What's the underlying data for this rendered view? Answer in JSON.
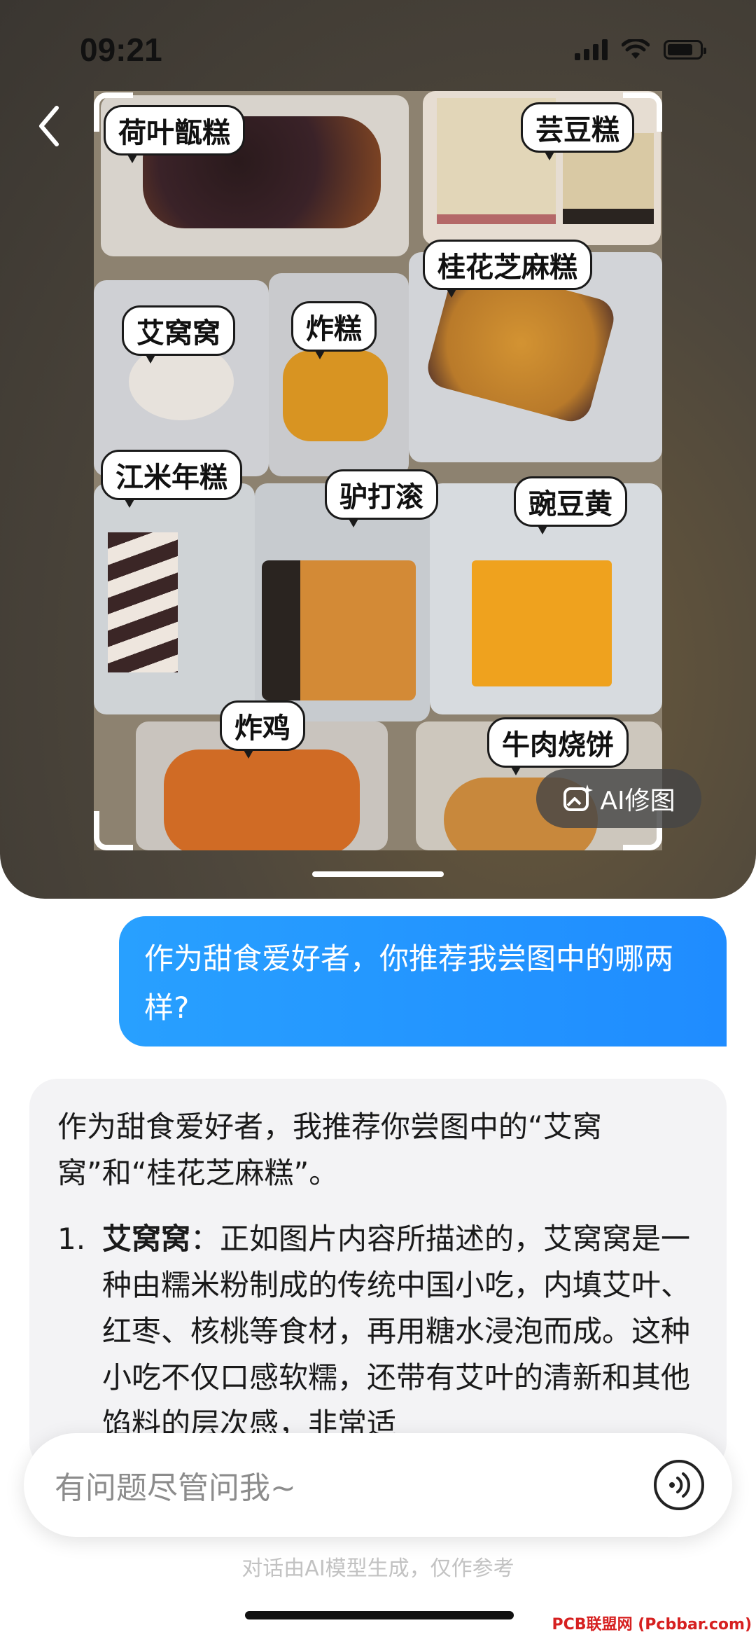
{
  "status_bar": {
    "time": "09:21"
  },
  "photo": {
    "labels": {
      "heye_zhengao": "荷叶甑糕",
      "yundougao": "芸豆糕",
      "guihua_zhimagao": "桂花芝麻糕",
      "aiwowo": "艾窝窝",
      "zhagao": "炸糕",
      "jiangmi_niangao": "江米年糕",
      "lvdagun": "驴打滚",
      "wandouhuang": "豌豆黄",
      "zhaji": "炸鸡",
      "niurou_shaobing": "牛肉烧饼"
    },
    "ai_edit_label": "AI修图"
  },
  "chat": {
    "user_message": "作为甜食爱好者，你推荐我尝图中的哪两样?",
    "ai_intro": "作为甜食爱好者，我推荐你尝图中的“艾窝窝”和“桂花芝麻糕”。",
    "ai_items": [
      {
        "num": "1.",
        "title": "艾窝窝",
        "text": "：正如图片内容所描述的，艾窝窝是一种由糯米粉制成的传统中国小吃，内填艾叶、红枣、核桃等食材，再用糖水浸泡而成。这种小吃不仅口感软糯，还带有艾叶的清新和其他馅料的层次感，非常适"
      }
    ]
  },
  "input": {
    "placeholder": "有问题尽管问我~"
  },
  "disclaimer": "对话由AI模型生成，仅作参考",
  "watermark": "PCB联盟网 (Pcbbar.com)",
  "colors": {
    "user_bubble": "#1f8cff",
    "ai_card": "#f3f3f5"
  }
}
